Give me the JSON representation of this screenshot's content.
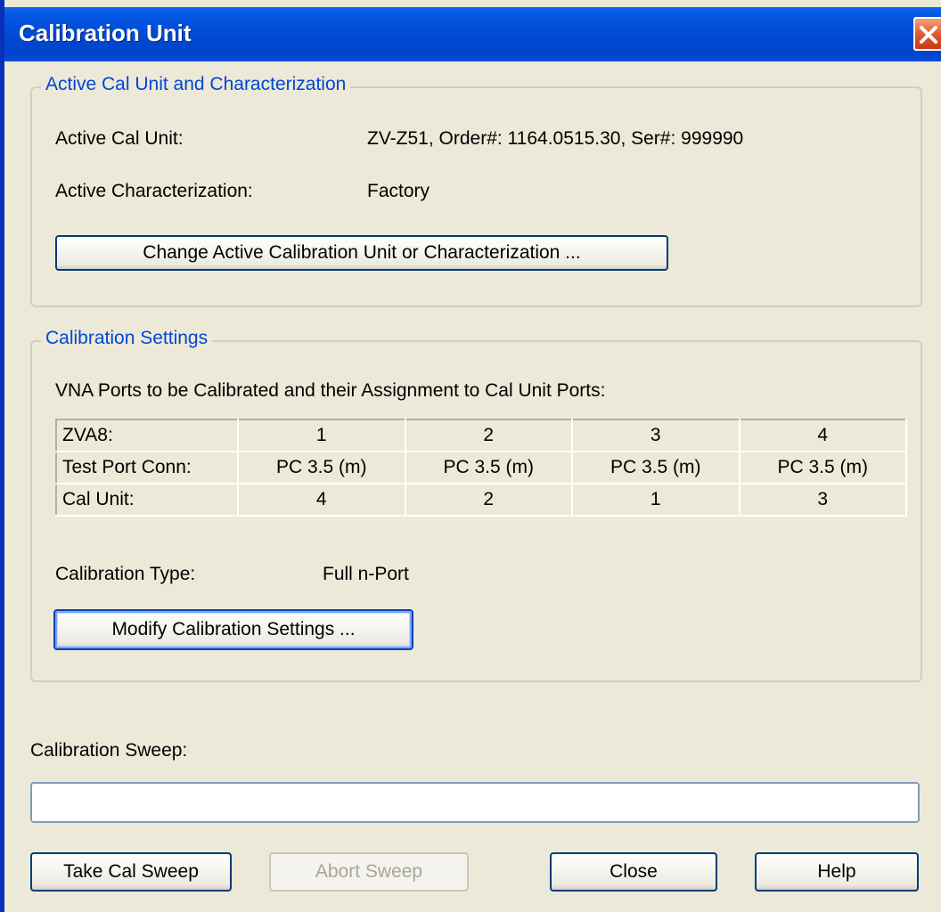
{
  "window": {
    "title": "Calibration Unit"
  },
  "active_group": {
    "title": "Active Cal Unit and Characterization",
    "cal_unit_label": "Active Cal Unit:",
    "cal_unit_value": "ZV-Z51, Order#: 1164.0515.30, Ser#: 999990",
    "characterization_label": "Active Characterization:",
    "characterization_value": "Factory",
    "change_button": "Change Active Calibration Unit or Characterization ..."
  },
  "settings_group": {
    "title": "Calibration Settings",
    "ports_caption": "VNA Ports to be Calibrated and their Assignment to Cal Unit Ports:",
    "table": {
      "rows": [
        {
          "header": "ZVA8:",
          "cells": [
            "1",
            "2",
            "3",
            "4"
          ]
        },
        {
          "header": "Test Port Conn:",
          "cells": [
            "PC 3.5 (m)",
            "PC 3.5 (m)",
            "PC 3.5 (m)",
            "PC 3.5 (m)"
          ]
        },
        {
          "header": "Cal Unit:",
          "cells": [
            "4",
            "2",
            "1",
            "3"
          ]
        }
      ]
    },
    "cal_type_label": "Calibration Type:",
    "cal_type_value": "Full n-Port",
    "modify_button": "Modify Calibration Settings ..."
  },
  "sweep": {
    "label": "Calibration Sweep:",
    "progress": 0
  },
  "buttons": {
    "take": "Take Cal Sweep",
    "abort": "Abort Sweep",
    "close": "Close",
    "help": "Help"
  },
  "colors": {
    "titlebar": "#0049d4",
    "group_title": "#0046d5",
    "dialog_bg": "#ece9d8",
    "close_button": "#e0542a"
  },
  "icons": {
    "close": "close-x-icon"
  }
}
